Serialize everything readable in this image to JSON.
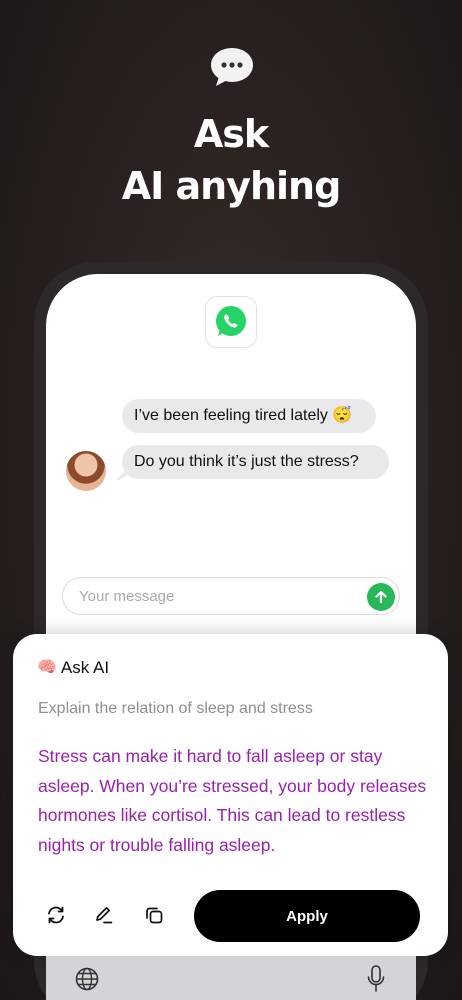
{
  "hero": {
    "icon": "speech-bubble-icon",
    "line1": "Ask",
    "line2": "AI anyhing"
  },
  "chat": {
    "app_icon": "whatsapp-icon",
    "messages": [
      {
        "text": "I’ve been feeling tired lately 😴"
      },
      {
        "text": "Do you think it’s just the stress?"
      }
    ],
    "input_placeholder": "Your message",
    "send_icon": "arrow-up-icon",
    "accent": "#27b859"
  },
  "ai_panel": {
    "icon": "brain-icon",
    "title": "Ask AI",
    "prompt": "Explain the relation of sleep and stress",
    "answer": "Stress can make it hard to fall asleep or stay asleep. When you’re stressed, your body releases hormones like cortisol. This can lead to restless nights or trouble falling asleep.",
    "answer_color": "#9a1fb0",
    "tools": [
      "refresh-icon",
      "edit-icon",
      "copy-icon"
    ],
    "apply_label": "Apply"
  },
  "keyboard": {
    "icons": [
      "globe-icon",
      "microphone-icon"
    ]
  }
}
